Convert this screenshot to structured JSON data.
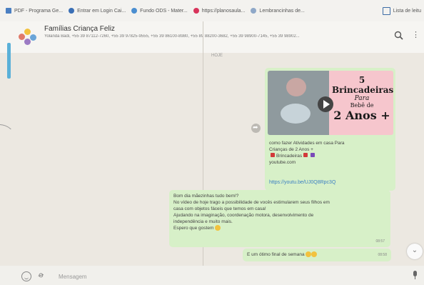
{
  "bookmarks": [
    {
      "label": "PDF - Programa Ge...",
      "icon": "bookmark-icon"
    },
    {
      "label": "Entrar em Login Cai...",
      "icon": "globe-icon"
    },
    {
      "label": "Fundo ODS - Mater...",
      "icon": "eye-icon"
    },
    {
      "label": "https://planosaula...",
      "icon": "heart-icon"
    },
    {
      "label": "Lembrancinhas de...",
      "icon": "search-icon"
    }
  ],
  "reading_list": {
    "label": "Lista de leitu",
    "icon": "reading-list-icon"
  },
  "chat": {
    "name": "Famílias Criança Feliz",
    "members": "Yolanda Badi, +55 39 87112-7260, +55 39 97825-9555, +55 39 86100-8980, +55 89 88200-3682, +55 39 98900-7145, +55 39 98902..."
  },
  "date_chip": "HOJE",
  "media_message": {
    "thumbnail": {
      "line1": "5 Brincadeiras",
      "line2": "Para",
      "line3": "Bebê de",
      "line4": "2 Anos +"
    },
    "line1": "como fazer Atividades em casa Para",
    "line2": "Crianças de 2 Anos +",
    "line3": "Brincadeiras",
    "line4": "youtube.com",
    "link": "https://youtu.be/UJ0Q8Rpc3Q"
  },
  "text_message": {
    "lines": [
      "Bom dia mãezinhas tudo bem!?",
      "No vídeo de hoje trago a possibilidade de vocês estimularem seus filhos em",
      "casa com objetos fáceis que temos em casa!",
      "Ajudando na imaginação, coordenação motora, desenvolvimento de",
      "independência e muito mais.",
      "Espero que gostem"
    ],
    "time": "08:57"
  },
  "last_message": {
    "text": "E um ótimo final de semana",
    "time": "08:58"
  },
  "composer": {
    "placeholder": "Mensagem"
  },
  "colors": {
    "bubble": "#d7f0c8",
    "link": "#3b7fc2",
    "thumb_pink": "#f6c6cd"
  }
}
